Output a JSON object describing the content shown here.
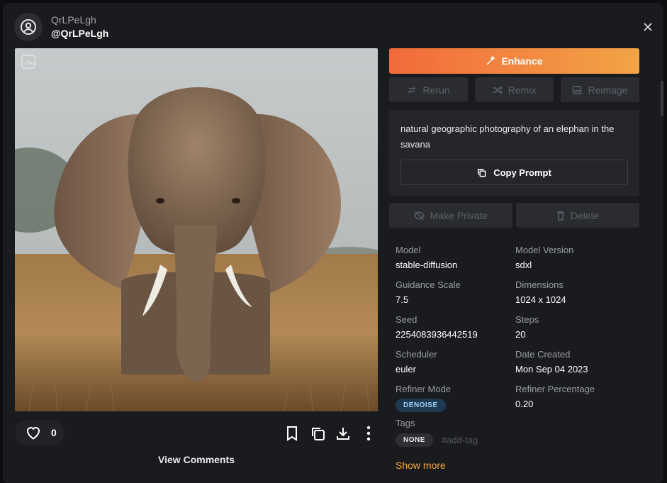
{
  "user": {
    "name": "QrLPeLgh",
    "handle": "@QrLPeLgh"
  },
  "actions": {
    "like_count": "0",
    "view_comments": "View Comments"
  },
  "buttons": {
    "enhance": "Enhance",
    "rerun": "Rerun",
    "remix": "Remix",
    "reimage": "Reimage",
    "copy_prompt": "Copy Prompt",
    "make_private": "Make Private",
    "delete": "Delete"
  },
  "prompt": "natural geographic photography of an elephan in the savana",
  "details": {
    "model_label": "Model",
    "model": "stable-diffusion",
    "model_version_label": "Model Version",
    "model_version": "sdxl",
    "guidance_label": "Guidance Scale",
    "guidance": "7.5",
    "dimensions_label": "Dimensions",
    "dimensions": "1024 x 1024",
    "seed_label": "Seed",
    "seed": "2254083936442519",
    "steps_label": "Steps",
    "steps": "20",
    "scheduler_label": "Scheduler",
    "scheduler": "euler",
    "date_label": "Date Created",
    "date": "Mon Sep 04 2023",
    "refiner_mode_label": "Refiner Mode",
    "refiner_mode": "DENOISE",
    "refiner_pct_label": "Refiner Percentage",
    "refiner_pct": "0.20"
  },
  "tags": {
    "label": "Tags",
    "none_badge": "NONE",
    "add_tag": "#add-tag"
  },
  "show_more": "Show more",
  "colors": {
    "accent_orange": "#f26a3b",
    "accent_yellow": "#f2a446",
    "link": "#f4a83e",
    "panel": "#1a1b1e"
  },
  "icons": [
    "user-circle-icon",
    "close-icon",
    "heart-icon",
    "bookmark-icon",
    "copy-icon",
    "download-icon",
    "more-vertical-icon",
    "wand-icon",
    "rerun-icon",
    "shuffle-icon",
    "image-icon",
    "eye-off-icon",
    "trash-icon"
  ]
}
